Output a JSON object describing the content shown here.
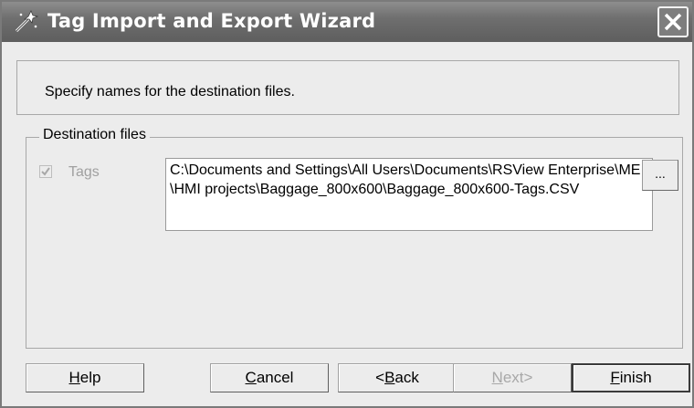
{
  "window": {
    "title": "Tag Import and Export Wizard",
    "icon": "wizard-wand-icon",
    "close_icon": "close-icon"
  },
  "header": {
    "instruction": "Specify names for the destination files."
  },
  "destination": {
    "group_label": "Destination files",
    "tags_label": "Tags",
    "tags_checked": true,
    "tags_enabled": false,
    "tags_path": "C:\\Documents and Settings\\All Users\\Documents\\RSView Enterprise\\ME\\HMI projects\\Baggage_800x600\\Baggage_800x600-Tags.CSV",
    "browse_label": "..."
  },
  "buttons": {
    "help": {
      "label": "Help",
      "mnemonic": "H",
      "rest": "elp"
    },
    "cancel": {
      "label": "Cancel",
      "mnemonic": "C",
      "rest": "ancel"
    },
    "back": {
      "label": "<Back",
      "prefix": "<",
      "mnemonic": "B",
      "rest": "ack"
    },
    "next": {
      "label": "Next>",
      "mnemonic": "N",
      "rest": "ext>",
      "enabled": false
    },
    "finish": {
      "label": "Finish",
      "mnemonic": "F",
      "rest": "inish"
    }
  }
}
